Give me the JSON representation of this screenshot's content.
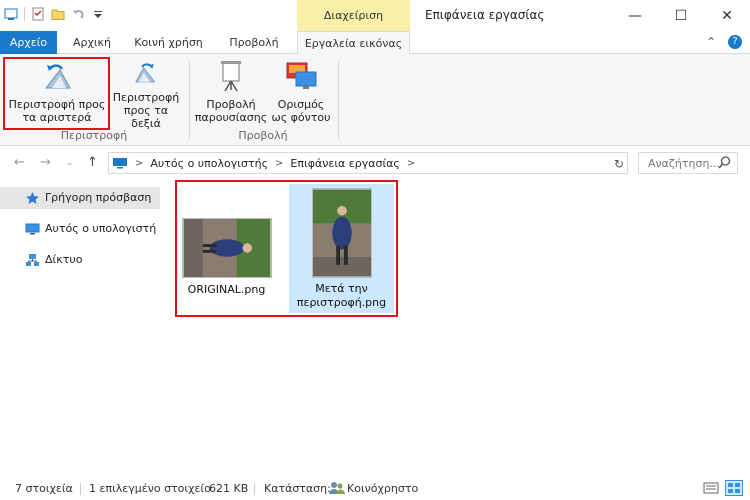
{
  "titlebar": {
    "context_header": "Διαχείριση",
    "window_title": "Επιφάνεια εργασίας",
    "minimize": "—",
    "maximize": "☐",
    "close": "✕"
  },
  "tabs": {
    "file": "Αρχείο",
    "home": "Αρχική",
    "share": "Κοινή χρήση",
    "view": "Προβολή",
    "picture_tools": "Εργαλεία εικόνας",
    "collapse": "⌃",
    "help": "?"
  },
  "ribbon": {
    "rotate_left_line1": "Περιστροφή προς",
    "rotate_left_line2": "τα αριστερά",
    "rotate_right_line1": "Περιστροφή",
    "rotate_right_line2": "προς τα δεξιά",
    "group_rotate": "Περιστροφή",
    "slideshow_line1": "Προβολή",
    "slideshow_line2": "παρουσίασης",
    "set_bg_line1": "Ορισμός",
    "set_bg_line2": "ως φόντου",
    "group_view": "Προβολή"
  },
  "address": {
    "crumb1": "Αυτός ο υπολογιστής",
    "crumb2": "Επιφάνεια εργασίας",
    "search_placeholder": "Αναζήτηση..."
  },
  "navpane": {
    "items": [
      {
        "label": "Γρήγορη πρόσβαση",
        "icon": "star-icon"
      },
      {
        "label": "Αυτός ο υπολογιστή",
        "icon": "computer-icon"
      },
      {
        "label": "Δίκτυο",
        "icon": "network-icon"
      }
    ]
  },
  "files": [
    {
      "name": "ORIGINAL.png",
      "selected": false
    },
    {
      "name_line1": "Μετά την",
      "name_line2": "περιστροφή.png",
      "selected": true
    }
  ],
  "status": {
    "count": "7 στοιχεία",
    "selected": "1 επιλεγμένο στοιχείο",
    "size": "621 KB",
    "state_label": "Κατάσταση:",
    "state_value": "Κοινόχρηστο"
  },
  "colors": {
    "accent": "#1979ca",
    "context_tab": "#f8f0a8",
    "highlight": "#e8101b",
    "selection": "#cce8ff"
  }
}
